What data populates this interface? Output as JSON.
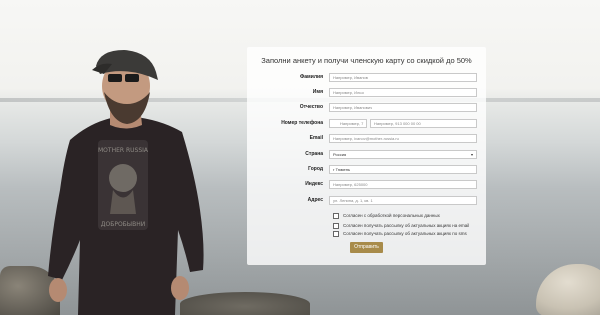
{
  "form": {
    "title": "Заполни анкету и получи членскую карту со скидкой до 50%",
    "fields": [
      {
        "label": "Фамилия",
        "placeholder": "Например, Иванов"
      },
      {
        "label": "Имя",
        "placeholder": "Например, Илья"
      },
      {
        "label": "Отчество",
        "placeholder": "Например, Иванович"
      },
      {
        "label": "Номер телефона",
        "code_placeholder": "Например, 7",
        "phone_placeholder": "Например, 913 000 00 00"
      },
      {
        "label": "Email",
        "placeholder": "Например, ivanov@mother-russia.ru"
      },
      {
        "label": "Страна",
        "value": "Россия"
      },
      {
        "label": "Город",
        "value": "г Тюмень"
      },
      {
        "label": "Индекс",
        "placeholder": "Например, 625000"
      },
      {
        "label": "Адрес",
        "placeholder": "ул. Ленина, д. 1, кв. 1"
      }
    ],
    "checkboxes": [
      "Согласен с обработкой персональных данных",
      "Согласен получать рассылку об актуальных акциях на email",
      "Согласен получать рассылку об актуальных акциях по sms"
    ],
    "submit_label": "Отправить"
  },
  "colors": {
    "submit": "#a88b4a",
    "panel": "#ffffff"
  }
}
